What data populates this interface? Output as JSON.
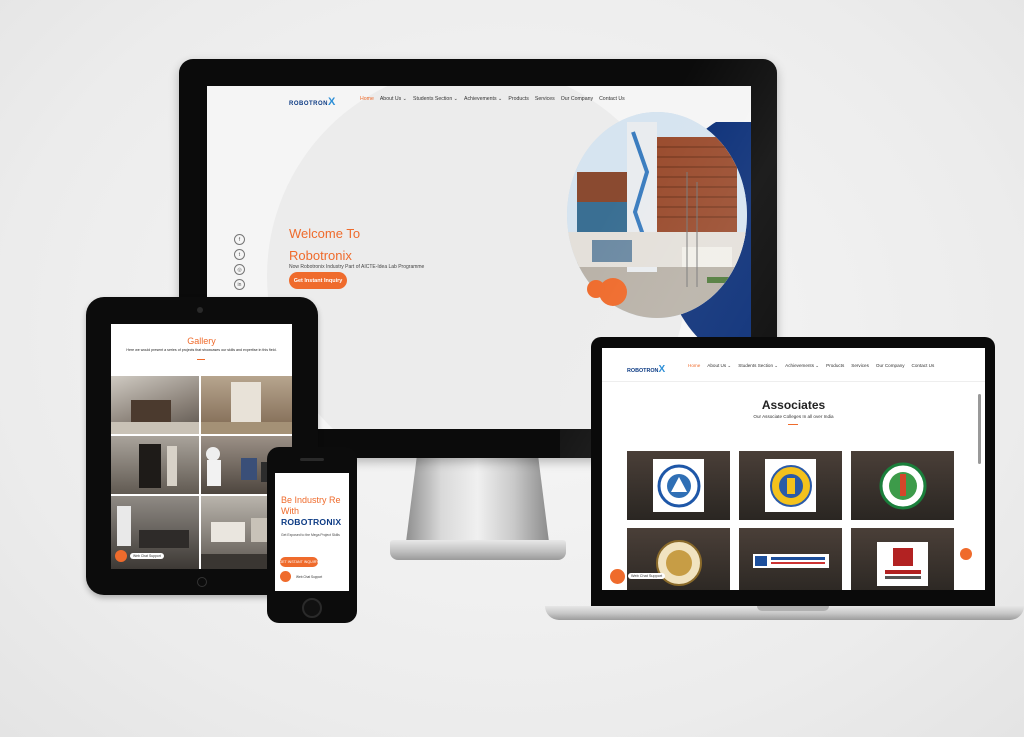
{
  "colors": {
    "accent": "#ef6b2c",
    "navy": "#0b2f78",
    "brand_blue": "#0d3b84"
  },
  "monitor": {
    "logo_text": "ROBOTRON",
    "logo_x": "X",
    "nav": [
      "Home",
      "About Us ⌄",
      "Students Section ⌄",
      "Achievements ⌄",
      "Products",
      "Services",
      "Our Company",
      "Contact Us"
    ],
    "social_icons": [
      "facebook-icon",
      "twitter-icon",
      "instagram-icon",
      "linkedin-icon"
    ],
    "social_glyphs": [
      "f",
      "t",
      "◎",
      "in"
    ],
    "welcome_line1": "Welcome To",
    "welcome_line2": "Robotronix",
    "subtitle": "Now Robotronix Industry Part of AICTE-Idea Lab Programme",
    "cta": "Get Instant Inquiry"
  },
  "laptop": {
    "logo_text": "ROBOTRON",
    "logo_x": "X",
    "nav": [
      "Home",
      "About Us ⌄",
      "Students Section ⌄",
      "Achievements ⌄",
      "Products",
      "Services",
      "Our Company",
      "Contact Us"
    ],
    "section_title": "Associates",
    "section_subtitle": "Our Associate Colleges In all over India",
    "chat_label": "Web Chat Support"
  },
  "tablet": {
    "title": "Gallery",
    "subtitle": "Here we would present a series of projects that showcases our skills and expertise in this field.",
    "chat_label": "Web Chat Support"
  },
  "phone": {
    "headline1": "Be Industry Re",
    "headline2": "With",
    "brand": "ROBOTRONIX",
    "small": "Get Exposed to the Mega Project Skills",
    "cta": "GET INSTANT INQUIRY",
    "chat_label": "Web Chat Support"
  }
}
